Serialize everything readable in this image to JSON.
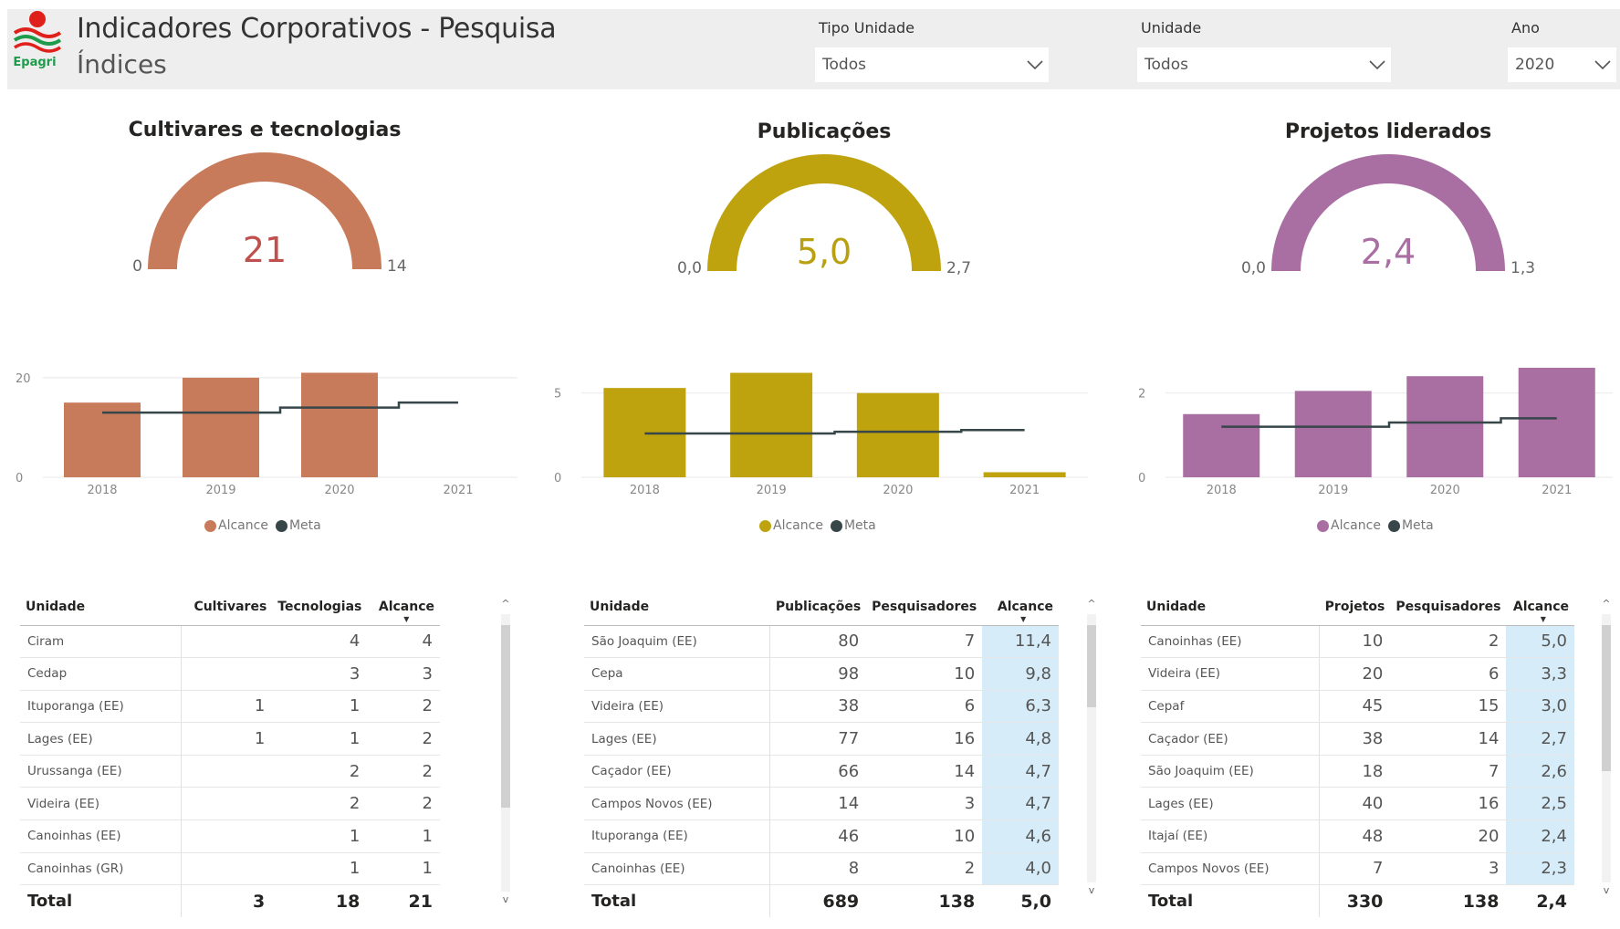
{
  "header": {
    "title": "Indicadores Corporativos - Pesquisa",
    "subtitle": "Índices",
    "logo_text": "Epagri"
  },
  "filters": [
    {
      "label": "Tipo Unidade",
      "value": "Todos"
    },
    {
      "label": "Unidade",
      "value": "Todos"
    },
    {
      "label": "Ano",
      "value": "2020"
    }
  ],
  "gauges": [
    {
      "title": "Cultivares e tecnologias",
      "value": "21",
      "min": "0",
      "max": "14",
      "color": "#c87b5a",
      "valueColor": "#c0504d"
    },
    {
      "title": "Publicações",
      "value": "5,0",
      "min": "0,0",
      "max": "2,7",
      "color": "#bea30f",
      "valueColor": "#b8a010"
    },
    {
      "title": "Projetos liderados",
      "value": "2,4",
      "min": "0,0",
      "max": "1,3",
      "color": "#a96ea2",
      "valueColor": "#a96ea2"
    }
  ],
  "legend": {
    "alcance": "Alcance",
    "meta": "Meta",
    "meta_color": "#374649"
  },
  "chart_data": [
    {
      "type": "bar",
      "categories": [
        "2018",
        "2019",
        "2020",
        "2021"
      ],
      "series": [
        {
          "name": "Alcance",
          "values": [
            15,
            20,
            21,
            0
          ]
        },
        {
          "name": "Meta",
          "type": "line",
          "values": [
            13,
            13,
            14,
            15
          ]
        }
      ],
      "ylim": [
        0,
        22
      ],
      "yticks": [
        "0",
        "20"
      ],
      "ytick_values": [
        0,
        20
      ],
      "color": "#c87b5a"
    },
    {
      "type": "bar",
      "categories": [
        "2018",
        "2019",
        "2020",
        "2021"
      ],
      "series": [
        {
          "name": "Alcance",
          "values": [
            5.3,
            6.2,
            5.0,
            0.3
          ]
        },
        {
          "name": "Meta",
          "type": "line",
          "values": [
            2.6,
            2.6,
            2.7,
            2.8
          ]
        }
      ],
      "ylim": [
        0,
        6.5
      ],
      "yticks": [
        "0",
        "5"
      ],
      "ytick_values": [
        0,
        5
      ],
      "color": "#bea30f"
    },
    {
      "type": "bar",
      "categories": [
        "2018",
        "2019",
        "2020",
        "2021"
      ],
      "series": [
        {
          "name": "Alcance",
          "values": [
            1.5,
            2.05,
            2.4,
            2.6
          ]
        },
        {
          "name": "Meta",
          "type": "line",
          "values": [
            1.2,
            1.2,
            1.3,
            1.4
          ]
        }
      ],
      "ylim": [
        0,
        2.6
      ],
      "yticks": [
        "0",
        "2"
      ],
      "ytick_values": [
        0,
        2
      ],
      "color": "#a96ea2"
    }
  ],
  "tables": [
    {
      "columns": [
        "Unidade",
        "Cultivares",
        "Tecnologias",
        "Alcance"
      ],
      "rows": [
        [
          "Ciram",
          "",
          "4",
          "4"
        ],
        [
          "Cedap",
          "",
          "3",
          "3"
        ],
        [
          "Ituporanga (EE)",
          "1",
          "1",
          "2"
        ],
        [
          "Lages (EE)",
          "1",
          "1",
          "2"
        ],
        [
          "Urussanga (EE)",
          "",
          "2",
          "2"
        ],
        [
          "Videira (EE)",
          "",
          "2",
          "2"
        ],
        [
          "Canoinhas (EE)",
          "",
          "1",
          "1"
        ],
        [
          "Canoinhas (GR)",
          "",
          "1",
          "1"
        ]
      ],
      "total": [
        "Total",
        "3",
        "18",
        "21"
      ]
    },
    {
      "columns": [
        "Unidade",
        "Publicações",
        "Pesquisadores",
        "Alcance"
      ],
      "rows": [
        [
          "São Joaquim (EE)",
          "80",
          "7",
          "11,4"
        ],
        [
          "Cepa",
          "98",
          "10",
          "9,8"
        ],
        [
          "Videira (EE)",
          "38",
          "6",
          "6,3"
        ],
        [
          "Lages (EE)",
          "77",
          "16",
          "4,8"
        ],
        [
          "Caçador (EE)",
          "66",
          "14",
          "4,7"
        ],
        [
          "Campos Novos (EE)",
          "14",
          "3",
          "4,7"
        ],
        [
          "Ituporanga (EE)",
          "46",
          "10",
          "4,6"
        ],
        [
          "Canoinhas (EE)",
          "8",
          "2",
          "4,0"
        ]
      ],
      "total": [
        "Total",
        "689",
        "138",
        "5,0"
      ]
    },
    {
      "columns": [
        "Unidade",
        "Projetos",
        "Pesquisadores",
        "Alcance"
      ],
      "rows": [
        [
          "Canoinhas (EE)",
          "10",
          "2",
          "5,0"
        ],
        [
          "Videira (EE)",
          "20",
          "6",
          "3,3"
        ],
        [
          "Cepaf",
          "45",
          "15",
          "3,0"
        ],
        [
          "Caçador (EE)",
          "38",
          "14",
          "2,7"
        ],
        [
          "São Joaquim (EE)",
          "18",
          "7",
          "2,6"
        ],
        [
          "Lages (EE)",
          "40",
          "16",
          "2,5"
        ],
        [
          "Itajaí (EE)",
          "48",
          "20",
          "2,4"
        ],
        [
          "Campos Novos (EE)",
          "7",
          "3",
          "2,3"
        ]
      ],
      "total": [
        "Total",
        "330",
        "138",
        "2,4"
      ]
    }
  ]
}
